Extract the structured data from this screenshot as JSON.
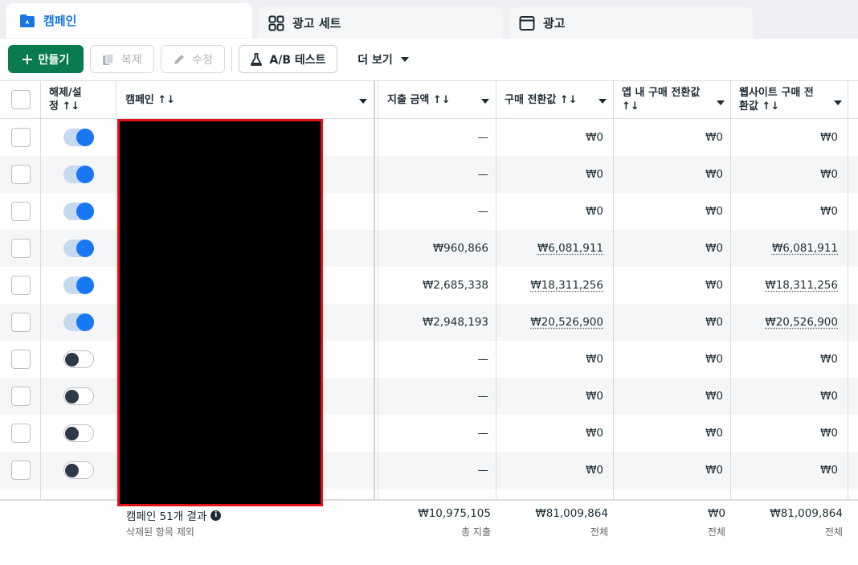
{
  "tabs": [
    {
      "label": "캠페인",
      "icon": "folder-icon",
      "active": true
    },
    {
      "label": "광고 세트",
      "icon": "grid-icon",
      "active": false
    },
    {
      "label": "광고",
      "icon": "ad-window-icon",
      "active": false
    }
  ],
  "toolbar": {
    "create_label": "만들기",
    "duplicate_label": "복제",
    "edit_label": "수정",
    "ab_test_label": "A/B 테스트",
    "more_label": "더 보기"
  },
  "columns": {
    "toggle": "해제/설정 ↑↓",
    "toggle_line1": "해제/설",
    "toggle_line2": "정 ↑↓",
    "campaign": "캠페인 ↑↓",
    "spend": "지출 금액 ↑↓",
    "purchase_value": "구매 전환값 ↑↓",
    "app_purchase_line1": "앱 내 구매 전환값",
    "app_purchase_line2": "↑↓",
    "web_purchase_line1": "웹사이트 구매 전",
    "web_purchase_line2": "환값 ↑↓"
  },
  "rows": [
    {
      "on": true,
      "spend": "—",
      "purchase_value": "₩0",
      "app_value": "₩0",
      "web_value": "₩0"
    },
    {
      "on": true,
      "spend": "—",
      "purchase_value": "₩0",
      "app_value": "₩0",
      "web_value": "₩0"
    },
    {
      "on": true,
      "spend": "—",
      "purchase_value": "₩0",
      "app_value": "₩0",
      "web_value": "₩0"
    },
    {
      "on": true,
      "spend": "₩960,866",
      "purchase_value": "₩6,081,911",
      "app_value": "₩0",
      "web_value": "₩6,081,911"
    },
    {
      "on": true,
      "spend": "₩2,685,338",
      "purchase_value": "₩18,311,256",
      "app_value": "₩0",
      "web_value": "₩18,311,256"
    },
    {
      "on": true,
      "spend": "₩2,948,193",
      "purchase_value": "₩20,526,900",
      "app_value": "₩0",
      "web_value": "₩20,526,900"
    },
    {
      "on": false,
      "spend": "—",
      "purchase_value": "₩0",
      "app_value": "₩0",
      "web_value": "₩0"
    },
    {
      "on": false,
      "spend": "—",
      "purchase_value": "₩0",
      "app_value": "₩0",
      "web_value": "₩0"
    },
    {
      "on": false,
      "spend": "—",
      "purchase_value": "₩0",
      "app_value": "₩0",
      "web_value": "₩0"
    },
    {
      "on": false,
      "spend": "—",
      "purchase_value": "₩0",
      "app_value": "₩0",
      "web_value": "₩0"
    }
  ],
  "footer": {
    "results": "캠페인 51개 결과",
    "excluded": "삭제된 항목 제외",
    "total_spend": "₩10,975,105",
    "total_spend_label": "총 지출",
    "total_purchase": "₩81,009,864",
    "total_purchase_label": "전체",
    "total_app": "₩0",
    "total_app_label": "전체",
    "total_web": "₩81,009,864",
    "total_web_label": "전체"
  },
  "colors": {
    "accent": "#1b74e4",
    "create_button": "#0a7b4f",
    "toggle_on": "#1877f2",
    "redaction_border": "#e0131a"
  }
}
